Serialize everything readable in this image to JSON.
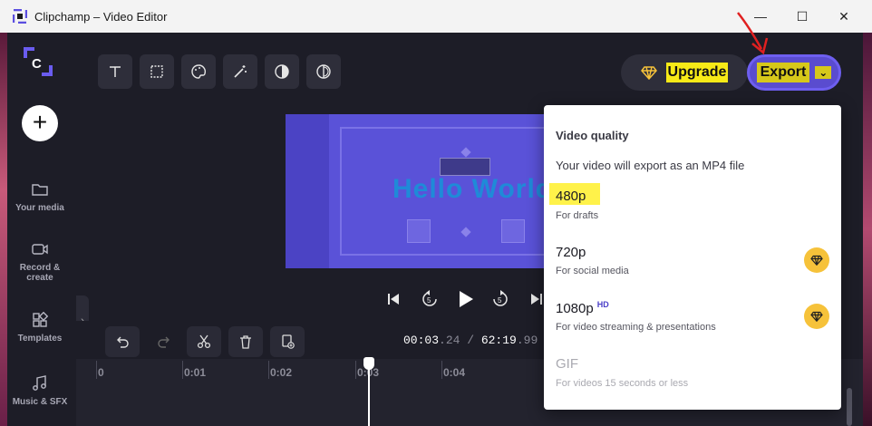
{
  "window": {
    "title": "Clipchamp – Video Editor",
    "minimize_glyph": "—",
    "maximize_glyph": "☐",
    "close_glyph": "✕"
  },
  "sidebar": {
    "add_glyph": "+",
    "items": [
      {
        "label": "Your media",
        "icon": "folder-icon"
      },
      {
        "label": "Record & create",
        "icon": "camera-icon"
      },
      {
        "label": "Templates",
        "icon": "templates-icon"
      },
      {
        "label": "Music & SFX",
        "icon": "music-icon"
      }
    ],
    "collapse_glyph": "›"
  },
  "toolbar": {
    "tools": [
      "text-icon",
      "crop-icon",
      "palette-icon",
      "magic-wand-icon",
      "contrast-icon",
      "filter-icon"
    ],
    "upgrade_label": "Upgrade",
    "export_label": "Export"
  },
  "preview": {
    "text": "Hello World"
  },
  "timeline": {
    "timecode_current_main": "00:03",
    "timecode_current_frac": ".24",
    "timecode_sep": " / ",
    "timecode_total_main": "62:19",
    "timecode_total_frac": ".99",
    "ticks": [
      "0",
      "0:01",
      "0:02",
      "0:03",
      "0:04"
    ]
  },
  "export_menu": {
    "heading": "Video quality",
    "description": "Your video will export as an MP4 file",
    "options": [
      {
        "title": "480p",
        "subtitle": "For drafts",
        "premium": false,
        "disabled": false,
        "highlighted": true
      },
      {
        "title": "720p",
        "subtitle": "For social media",
        "premium": true,
        "disabled": false
      },
      {
        "title": "1080p",
        "badge": "HD",
        "subtitle": "For video streaming & presentations",
        "premium": true,
        "disabled": false
      },
      {
        "title": "GIF",
        "subtitle": "For videos 15 seconds or less",
        "premium": false,
        "disabled": true
      }
    ]
  },
  "colors": {
    "accent": "#5a4ccf",
    "highlight": "#fff24a",
    "premium": "#f6c23a",
    "annotation": "#e02020"
  }
}
